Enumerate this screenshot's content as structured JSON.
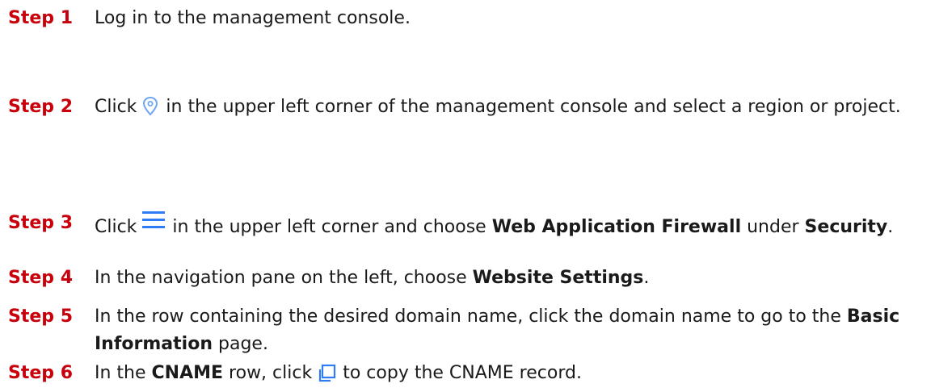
{
  "steps": [
    {
      "label": "Step 1",
      "text": "Log in to the management console."
    },
    {
      "label": "Step 2",
      "before": "Click",
      "icon": "location-pin-icon",
      "after": "in the upper left corner of the management console and select a region or project."
    },
    {
      "label": "Step 3",
      "before": "Click",
      "icon": "hamburger-menu-icon",
      "mid1": "in the upper left corner and choose",
      "bold1": "Web Application Firewall",
      "mid2": "under",
      "bold2": "Security",
      "end": "."
    },
    {
      "label": "Step 4",
      "before": "In the navigation pane on the left, choose",
      "bold1": "Website Settings",
      "end": "."
    },
    {
      "label": "Step 5",
      "before": "In the row containing the desired domain name, click the domain name to go to the",
      "bold1": "Basic Information",
      "end": "page."
    },
    {
      "label": "Step 6",
      "before": "In the",
      "bold1": "CNAME",
      "mid1": "row, click",
      "icon": "copy-icon",
      "end": "to copy the CNAME record."
    }
  ],
  "colors": {
    "step_label": "#c7000b",
    "text": "#1a1a1a",
    "icon_blue": "#2f7cf6",
    "icon_pin": "#6fa6f2"
  }
}
